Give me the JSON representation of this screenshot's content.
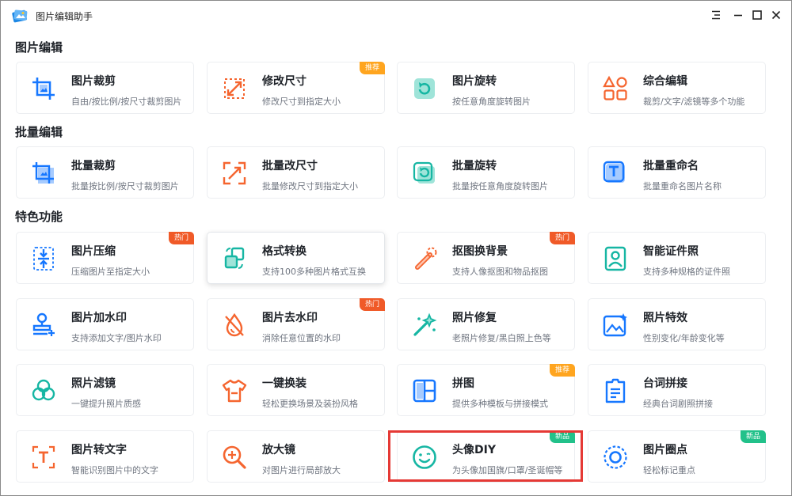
{
  "app": {
    "title": "图片编辑助手",
    "logo_icon": "app-logo-icon"
  },
  "window_controls": {
    "menu_icon": "menu-icon",
    "minimize_icon": "minimize-icon",
    "maximize_icon": "maximize-icon",
    "close_icon": "close-icon"
  },
  "colors": {
    "accent_blue": "#1677ff",
    "orange": "#f5652f",
    "teal": "#16b6a3",
    "hot_badge": "#f05a28",
    "recommend_badge": "#ffa51f",
    "new_badge": "#22c18a",
    "highlight": "#e53935"
  },
  "sections": [
    {
      "title": "图片编辑"
    },
    {
      "title": "批量编辑"
    },
    {
      "title": "特色功能"
    }
  ],
  "cards": [
    {
      "title": "图片裁剪",
      "desc": "自由/按比例/按尺寸裁剪图片",
      "icon": "crop-icon"
    },
    {
      "title": "修改尺寸",
      "desc": "修改尺寸到指定大小",
      "icon": "resize-icon",
      "badge": "推荐"
    },
    {
      "title": "图片旋转",
      "desc": "按任意角度旋转图片",
      "icon": "rotate-icon"
    },
    {
      "title": "综合编辑",
      "desc": "裁剪/文字/滤镜等多个功能",
      "icon": "shapes-icon"
    },
    {
      "title": "批量裁剪",
      "desc": "批量按比例/按尺寸裁剪图片",
      "icon": "batch-crop-icon"
    },
    {
      "title": "批量改尺寸",
      "desc": "批量修改尺寸到指定大小",
      "icon": "batch-resize-icon"
    },
    {
      "title": "批量旋转",
      "desc": "批量按任意角度旋转图片",
      "icon": "batch-rotate-icon"
    },
    {
      "title": "批量重命名",
      "desc": "批量重命名图片名称",
      "icon": "rename-icon"
    },
    {
      "title": "图片压缩",
      "desc": "压缩图片至指定大小",
      "icon": "compress-icon",
      "badge": "热门"
    },
    {
      "title": "格式转换",
      "desc": "支持100多种图片格式互换",
      "icon": "convert-icon"
    },
    {
      "title": "抠图换背景",
      "desc": "支持人像抠图和物品抠图",
      "icon": "cutout-icon",
      "badge": "热门"
    },
    {
      "title": "智能证件照",
      "desc": "支持多种规格的证件照",
      "icon": "id-photo-icon"
    },
    {
      "title": "图片加水印",
      "desc": "支持添加文字/图片水印",
      "icon": "stamp-icon"
    },
    {
      "title": "图片去水印",
      "desc": "消除任意位置的水印",
      "icon": "remove-watermark-icon",
      "badge": "热门"
    },
    {
      "title": "照片修复",
      "desc": "老照片修复/黑白照上色等",
      "icon": "magic-wand-icon"
    },
    {
      "title": "照片特效",
      "desc": "性别变化/年龄变化等",
      "icon": "effects-icon"
    },
    {
      "title": "照片滤镜",
      "desc": "一键提升照片质感",
      "icon": "filter-icon"
    },
    {
      "title": "一键换装",
      "desc": "轻松更换场景及装扮风格",
      "icon": "shirt-icon"
    },
    {
      "title": "拼图",
      "desc": "提供多种模板与拼接模式",
      "icon": "collage-icon",
      "badge": "推荐"
    },
    {
      "title": "台词拼接",
      "desc": "经典台词剧照拼接",
      "icon": "subtitle-icon"
    },
    {
      "title": "图片转文字",
      "desc": "智能识别图片中的文字",
      "icon": "ocr-icon"
    },
    {
      "title": "放大镜",
      "desc": "对图片进行局部放大",
      "icon": "magnifier-icon"
    },
    {
      "title": "头像DIY",
      "desc": "为头像加国旗/口罩/圣诞帽等",
      "icon": "smiley-icon",
      "badge": "新品"
    },
    {
      "title": "图片圈点",
      "desc": "轻松标记重点",
      "icon": "circle-mark-icon",
      "badge": "新品"
    }
  ]
}
